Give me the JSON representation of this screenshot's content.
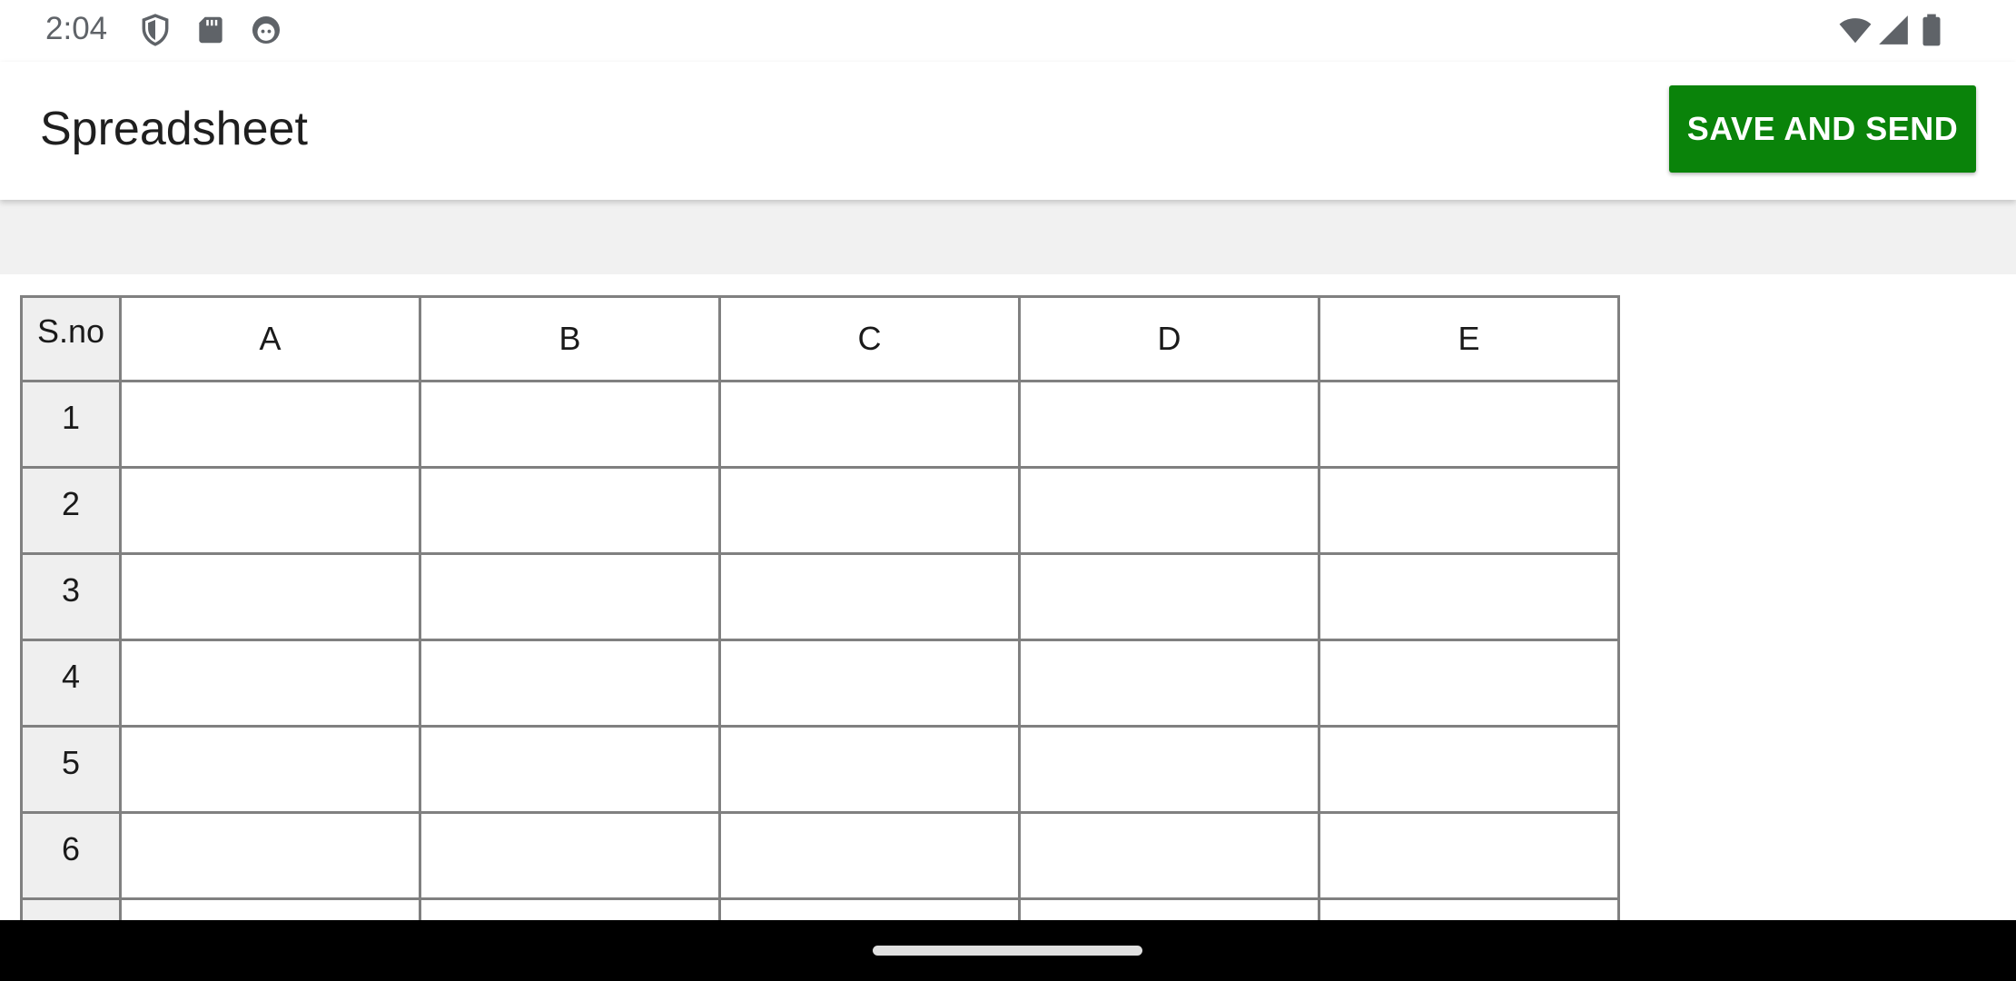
{
  "status_bar": {
    "time": "2:04",
    "left_icons": [
      "shield-icon",
      "sd-card-icon",
      "android-face-icon"
    ],
    "right_icons": [
      "wifi-icon",
      "cell-signal-icon",
      "battery-icon"
    ]
  },
  "app_bar": {
    "title": "Spreadsheet",
    "save_button_label": "SAVE AND SEND",
    "accent_color": "#0a830a"
  },
  "sheet": {
    "corner_header": "S.no",
    "columns": [
      "A",
      "B",
      "C",
      "D",
      "E"
    ],
    "rows": [
      {
        "num": "1",
        "cells": [
          "",
          "",
          "",
          "",
          ""
        ]
      },
      {
        "num": "2",
        "cells": [
          "",
          "",
          "",
          "",
          ""
        ]
      },
      {
        "num": "3",
        "cells": [
          "",
          "",
          "",
          "",
          ""
        ]
      },
      {
        "num": "4",
        "cells": [
          "",
          "",
          "",
          "",
          ""
        ]
      },
      {
        "num": "5",
        "cells": [
          "",
          "",
          "",
          "",
          ""
        ]
      },
      {
        "num": "6",
        "cells": [
          "",
          "",
          "",
          "",
          ""
        ]
      },
      {
        "num": "",
        "cells": [
          "",
          "",
          "",
          "",
          ""
        ]
      }
    ]
  }
}
